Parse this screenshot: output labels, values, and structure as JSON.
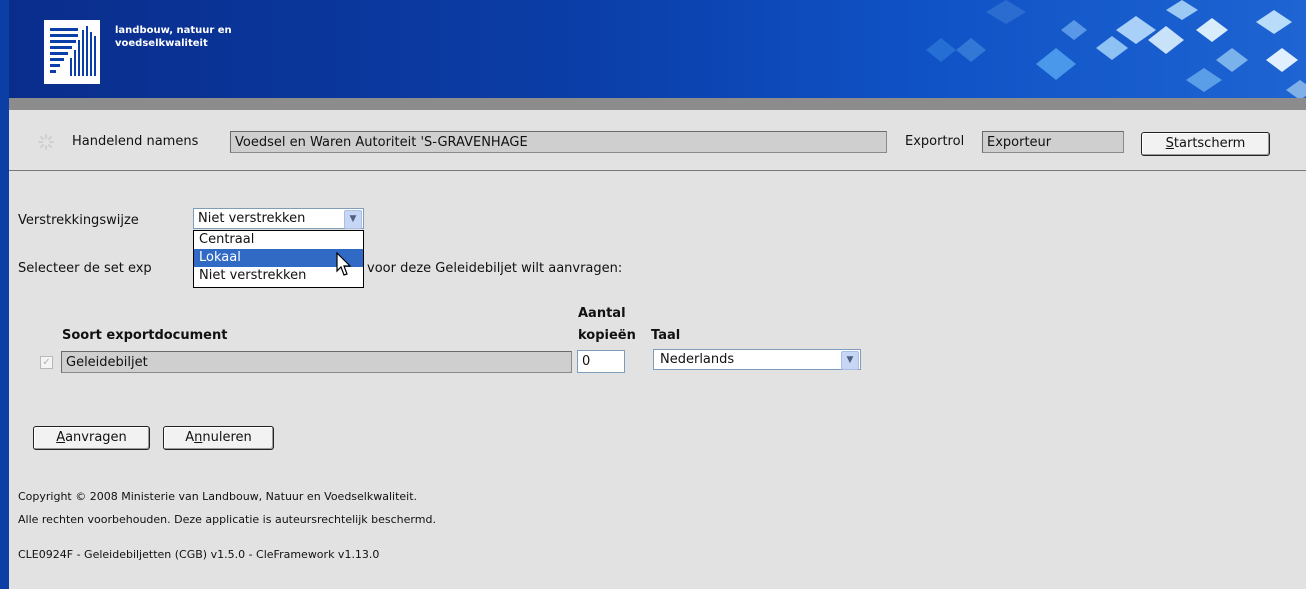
{
  "header": {
    "org_line1": "landbouw, natuur en",
    "org_line2": "voedselkwaliteit"
  },
  "context": {
    "acting_label": "Handelend namens",
    "acting_value": "Voedsel en Waren Autoriteit 'S-GRAVENHAGE",
    "role_label": "Exportrol",
    "role_value": "Exporteur",
    "start_button": "Startscherm",
    "start_accesskey": "S",
    "start_rest": "tartscherm"
  },
  "form": {
    "method_label": "Verstrekkingswijze",
    "method_selected": "Niet verstrekken",
    "method_options": [
      "Centraal",
      "Lokaal",
      "Niet verstrekken"
    ],
    "method_highlighted": "Lokaal",
    "instruction_part1": "Selecteer de set exp",
    "instruction_part2": "voor deze Geleidebiljet wilt aanvragen:"
  },
  "table": {
    "col_doc": "Soort exportdocument",
    "col_copies_line1": "Aantal",
    "col_copies_line2": "kopieën",
    "col_lang": "Taal",
    "rows": [
      {
        "document": "Geleidebiljet",
        "copies": "0",
        "language": "Nederlands",
        "checked": true
      }
    ]
  },
  "actions": {
    "request_button": "Aanvragen",
    "request_accesskey": "A",
    "request_rest": "anvragen",
    "cancel_button": "Annuleren",
    "cancel_pre": "A",
    "cancel_accesskey": "n",
    "cancel_rest": "nuleren"
  },
  "footer": {
    "copyright": "Copyright © 2008 Ministerie van Landbouw, Natuur en Voedselkwaliteit.",
    "rights": "Alle rechten voorbehouden. Deze applicatie is auteursrechtelijk beschermd.",
    "version": "CLE0924F - Geleidebiljetten (CGB) v1.5.0 - CleFramework v1.13.0"
  },
  "colors": {
    "banner": "#0b3ea8",
    "left_bar": "#0b3fa6",
    "selection": "#316ac5",
    "background": "#e2e2e2"
  }
}
